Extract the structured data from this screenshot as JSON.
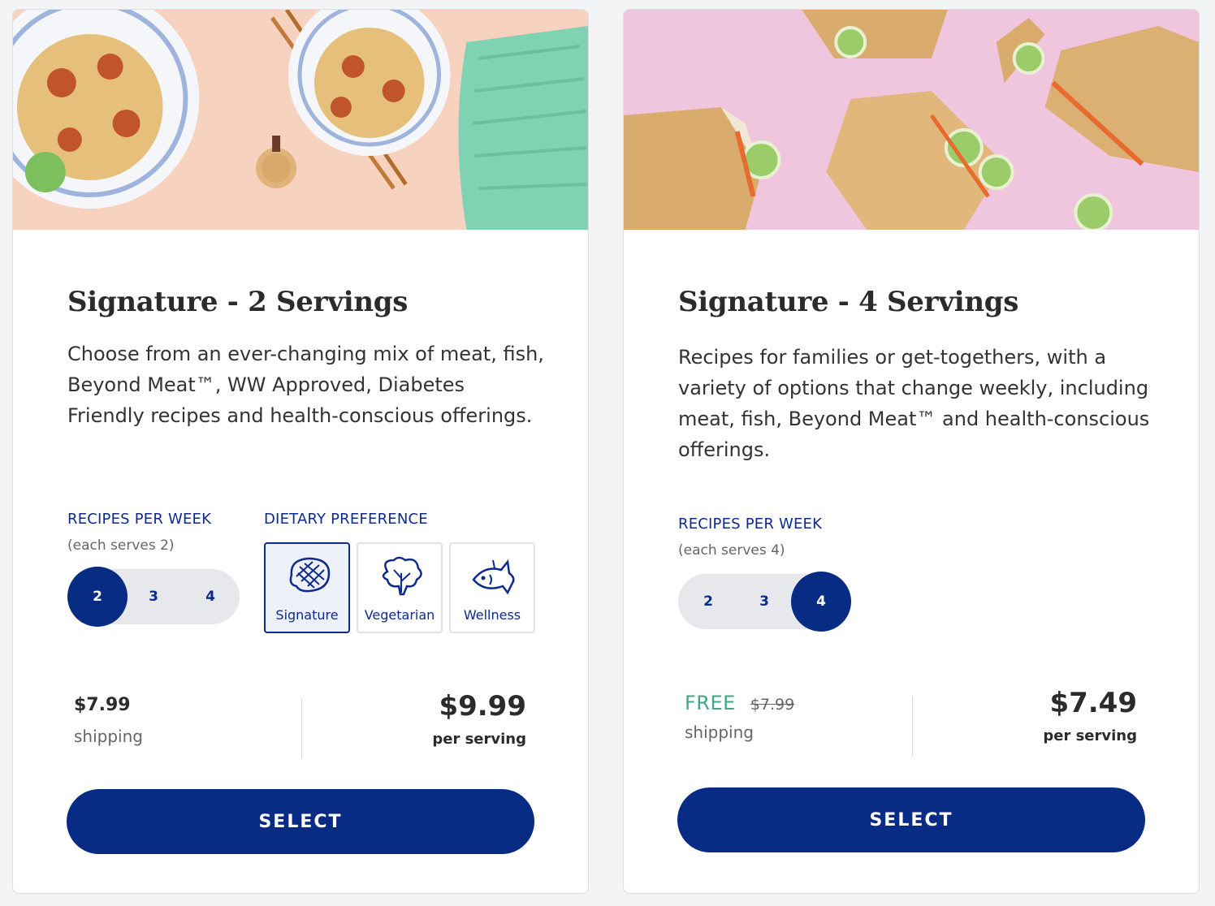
{
  "plans": [
    {
      "title": "Signature - 2 Servings",
      "description": "Choose from an ever-changing mix of meat, fish, Beyond Meat™, WW Approved, Diabetes Friendly recipes and health-conscious offerings.",
      "recipes_label": "RECIPES PER WEEK",
      "serves_note": "(each serves 2)",
      "recipe_options": [
        "2",
        "3",
        "4"
      ],
      "selected_recipes": "2",
      "dietary_label": "DIETARY PREFERENCE",
      "dietary_options": [
        "Signature",
        "Vegetarian",
        "Wellness"
      ],
      "selected_dietary": "Signature",
      "shipping_price": "$7.99",
      "shipping_label": "shipping",
      "price": "$9.99",
      "price_unit": "per serving",
      "select_label": "SELECT"
    },
    {
      "title": "Signature - 4 Servings",
      "description": "Recipes for families or get-togethers, with a variety of options that change weekly, including meat, fish, Beyond Meat™ and health-conscious offerings.",
      "recipes_label": "RECIPES PER WEEK",
      "serves_note": "(each serves 4)",
      "recipe_options": [
        "2",
        "3",
        "4"
      ],
      "selected_recipes": "4",
      "shipping_free": "FREE",
      "shipping_original": "$7.99",
      "shipping_label": "shipping",
      "price": "$7.49",
      "price_unit": "per serving",
      "select_label": "SELECT"
    }
  ],
  "colors": {
    "primary": "#082b83",
    "free_green": "#3fa887",
    "hero1_bg": "#f7d2bf",
    "hero2_bg": "#f0c6df"
  }
}
